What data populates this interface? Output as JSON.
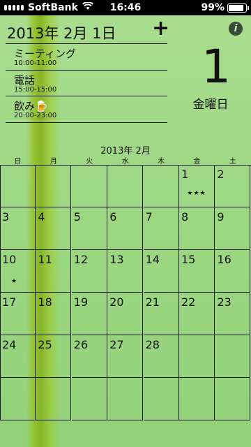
{
  "status_bar": {
    "carrier": "SoftBank",
    "time": "16:46",
    "battery": "99%"
  },
  "header": {
    "date_title": "2013年 2月 1日",
    "add_label": "+",
    "info_label": "i"
  },
  "events": [
    {
      "title": "ミーティング",
      "time": "10:00-11:00"
    },
    {
      "title": "電話",
      "time": "15:00-15:00"
    },
    {
      "title": "飲み🍺",
      "time": "20:00-23:00"
    }
  ],
  "selected_day": {
    "number": "1",
    "weekday": "金曜日"
  },
  "calendar": {
    "month_title": "2013年 2月",
    "weekdays": [
      "日",
      "月",
      "火",
      "水",
      "木",
      "金",
      "土"
    ],
    "weeks": [
      [
        {
          "day": ""
        },
        {
          "day": ""
        },
        {
          "day": ""
        },
        {
          "day": ""
        },
        {
          "day": ""
        },
        {
          "day": "1",
          "stars": "★★★"
        },
        {
          "day": "2"
        }
      ],
      [
        {
          "day": "3"
        },
        {
          "day": "4"
        },
        {
          "day": "5"
        },
        {
          "day": "6"
        },
        {
          "day": "7"
        },
        {
          "day": "8"
        },
        {
          "day": "9"
        }
      ],
      [
        {
          "day": "10",
          "stars": "★"
        },
        {
          "day": "11"
        },
        {
          "day": "12"
        },
        {
          "day": "13"
        },
        {
          "day": "14"
        },
        {
          "day": "15"
        },
        {
          "day": "16"
        }
      ],
      [
        {
          "day": "17"
        },
        {
          "day": "18"
        },
        {
          "day": "19"
        },
        {
          "day": "20"
        },
        {
          "day": "21"
        },
        {
          "day": "22"
        },
        {
          "day": "23"
        }
      ],
      [
        {
          "day": "24"
        },
        {
          "day": "25"
        },
        {
          "day": "26"
        },
        {
          "day": "27"
        },
        {
          "day": "28"
        },
        {
          "day": ""
        },
        {
          "day": ""
        }
      ],
      [
        {
          "day": ""
        },
        {
          "day": ""
        },
        {
          "day": ""
        },
        {
          "day": ""
        },
        {
          "day": ""
        },
        {
          "day": ""
        },
        {
          "day": ""
        }
      ]
    ]
  }
}
